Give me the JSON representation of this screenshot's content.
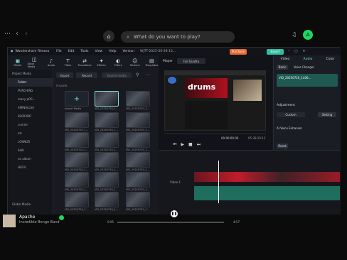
{
  "topbar": {
    "search_placeholder": "What do you want to play?"
  },
  "window": {
    "app_title": "Wondershare Filmora",
    "menu": [
      "File",
      "Edit",
      "Tools",
      "View",
      "Help",
      "Version"
    ],
    "project_name": "WJTT-2025-06-28 13...",
    "purchase_label": "Purchase",
    "export_label": "Export",
    "tools": [
      "Media",
      "Stock Media",
      "Audio",
      "Titles",
      "Transitions",
      "Effects",
      "Filters",
      "Stickers",
      "Templates"
    ],
    "sidebar": [
      "Project Media",
      "Folder",
      "PUNCHING",
      "many pOS...",
      "AMINALLSA",
      "BLOXXBO",
      "cummi",
      "olz",
      "cONNOR",
      "bibb",
      "no album",
      "HGVV",
      "Global Media"
    ],
    "media_toolbar": {
      "import": "Import",
      "record": "Record",
      "search": "Search media"
    },
    "folder_label": "FOLDER",
    "import_media": "Import Media",
    "clip_label": "VID_20250720_1...",
    "player": {
      "label": "Player",
      "quality": "Full Quality",
      "current_time": "00:00:00:00",
      "total_time": "05:38:20:13",
      "screen_title": "drums"
    },
    "props": {
      "tabs": [
        "Video",
        "Audio",
        "Color"
      ],
      "sub_tabs": [
        "Basic",
        "Voice Changer"
      ],
      "clip_name": "VID_20250720_1406...",
      "adjustment_label": "Adjustment",
      "custom_label": "Custom",
      "setting_label": "Setting",
      "ai_voice_label": "AI Voice Enhancer",
      "reset_label": "Reset"
    },
    "track_label": "Video 1"
  },
  "bottombar": {
    "track_title": "Apache",
    "artist": "Incredible Bongo Band",
    "time_elapsed": "0:05",
    "time_total": "4:57"
  }
}
